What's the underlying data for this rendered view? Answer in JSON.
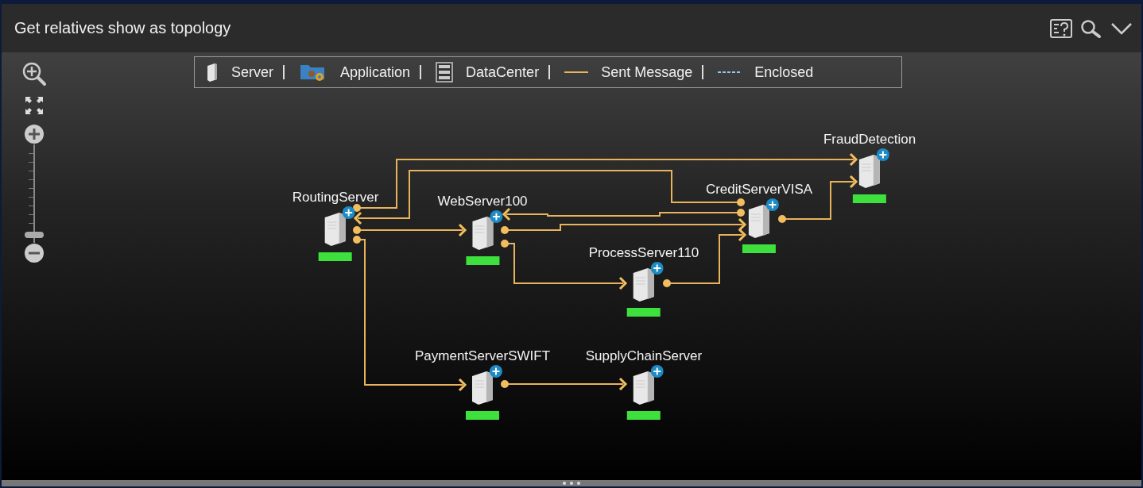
{
  "window": {
    "title": "Get relatives show as topology"
  },
  "legend": [
    {
      "kind": "server",
      "label": "Server"
    },
    {
      "kind": "application",
      "label": "Application"
    },
    {
      "kind": "datacenter",
      "label": "DataCenter"
    },
    {
      "kind": "line",
      "label": "Sent Message"
    },
    {
      "kind": "dashed",
      "label": "Enclosed"
    }
  ],
  "zoom_slider": {
    "level": 0.05
  },
  "nodes": [
    {
      "name": "RoutingServer",
      "color": "#3ee03e"
    },
    {
      "name": "WebServer100",
      "color": "#3ee03e"
    },
    {
      "name": "ProcessServer110",
      "color": "#3ee03e"
    },
    {
      "name": "CreditServerVISA",
      "color": "#3ee03e"
    },
    {
      "name": "FraudDetection",
      "color": "#3ee03e"
    },
    {
      "name": "PaymentServerSWIFT",
      "color": "#3ee03e"
    },
    {
      "name": "SupplyChainServer",
      "color": "#3ee03e"
    }
  ]
}
